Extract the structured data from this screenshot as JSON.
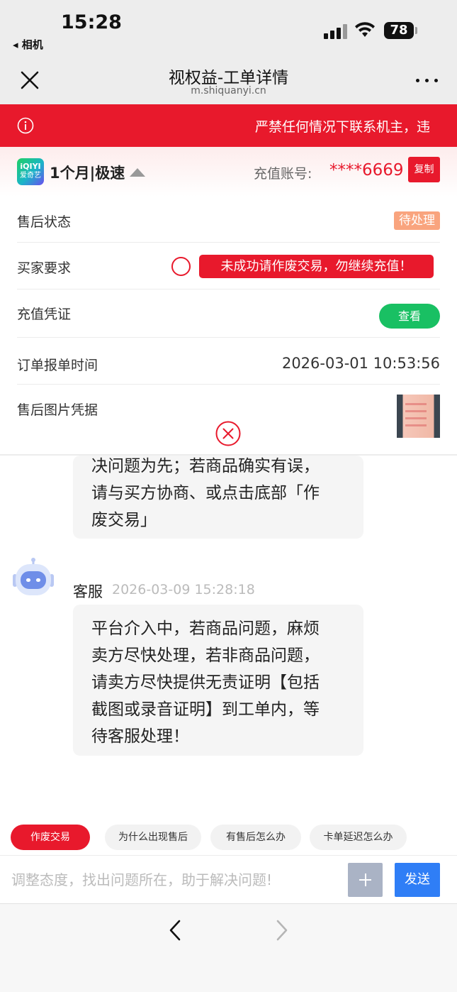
{
  "status_bar": {
    "time": "15:28",
    "back_app": "◂ 相机",
    "battery": "78"
  },
  "nav": {
    "title": "视权益-工单详情",
    "url": "m.shiquanyi.cn"
  },
  "notice": {
    "text": "严禁任何情况下联系机主，违"
  },
  "product": {
    "logo_line1": "iQIYI",
    "logo_line2": "爱奇艺",
    "name": "1个月|极速",
    "account_label": "充值账号:",
    "account_value": "****6669",
    "copy_label": "复制"
  },
  "rows": {
    "status_label": "售后状态",
    "status_value": "待处理",
    "buyer_label": "买家要求",
    "buyer_request": "未成功请作废交易，勿继续充值！",
    "proof_label": "充值凭证",
    "proof_button": "查看",
    "time_label": "订单报单时间",
    "time_value": "2026-03-01 10:53:56",
    "image_label": "售后图片凭据"
  },
  "chat": {
    "prev_lines": [
      "决问题为先；若商品确实有误，",
      "请与买方协商、或点击底部「作",
      "废交易」"
    ],
    "sender": "客服",
    "sender_time": "2026-03-09 15:28:18",
    "lines": [
      "平台介入中，若商品问题，麻烦",
      "卖方尽快处理，若非商品问题，",
      "请卖方尽快提供无责证明【包括",
      "截图或录音证明】到工单内，等",
      "待客服处理！"
    ]
  },
  "quick_replies": [
    "作废交易",
    "为什么出现售后",
    "有售后怎么办",
    "卡单延迟怎么办"
  ],
  "input": {
    "placeholder": "调整态度，找出问题所在，助于解决问题!",
    "send_label": "发送"
  },
  "colors": {
    "primary_red": "#e8192c",
    "green": "#19c063",
    "blue": "#2f7ef6",
    "badge_orange": "#f9a47e"
  },
  "icons": [
    "close-icon",
    "more-icon",
    "info-icon",
    "caret-up-icon",
    "x-circle-icon",
    "robot-avatar-icon",
    "plus-icon",
    "back-arrow-icon",
    "forward-arrow-icon"
  ]
}
